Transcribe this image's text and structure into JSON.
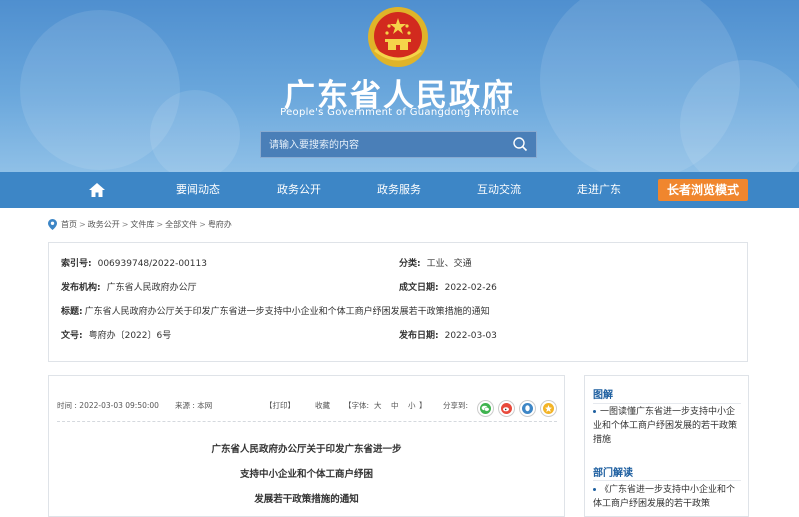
{
  "header": {
    "title": "广东省人民政府",
    "subtitle": "People's Government of Guangdong Province",
    "search_placeholder": "请输入要搜索的内容"
  },
  "nav": {
    "items": [
      "要闻动态",
      "政务公开",
      "政务服务",
      "互动交流",
      "走进广东"
    ],
    "elder_mode": "长者浏览模式"
  },
  "breadcrumb": [
    "首页",
    "政务公开",
    "文件库",
    "全部文件",
    "粤府办"
  ],
  "meta": {
    "index_label": "索引号:",
    "index_value": "006939748/2022-00113",
    "category_label": "分类:",
    "category_value": "工业、交通",
    "publisher_label": "发布机构:",
    "publisher_value": "广东省人民政府办公厅",
    "created_label": "成文日期:",
    "created_value": "2022-02-26",
    "title_label": "标题:",
    "title_value": "广东省人民政府办公厅关于印发广东省进一步支持中小企业和个体工商户纾困发展若干政策措施的通知",
    "docno_label": "文号:",
    "docno_value": "粤府办〔2022〕6号",
    "pubdate_label": "发布日期:",
    "pubdate_value": "2022-03-03"
  },
  "article": {
    "time": "时间 : 2022-03-03 09:50:00",
    "source": "来源 : 本网",
    "print": "【打印】",
    "favorite": "收藏",
    "font_label": "【字体:",
    "font_large": "大",
    "font_medium": "中",
    "font_small": "小",
    "font_close": "】",
    "share_label": "分享到:",
    "title_lines": [
      "广东省人民政府办公厅关于印发广东省进一步",
      "支持中小企业和个体工商户纾困",
      "发展若干政策措施的通知"
    ]
  },
  "sidebar": {
    "section1_title": "图解",
    "section1_link": "一图读懂广东省进一步支持中小企业和个体工商户纾困发展的若干政策措施",
    "section2_title": "部门解读",
    "section2_link": "《广东省进一步支持中小企业和个体工商户纾困发展的若干政策"
  },
  "colors": {
    "nav_blue": "#3d86c6",
    "elder_orange": "#f0862e",
    "sidebar_heading": "#1e5fa0"
  }
}
